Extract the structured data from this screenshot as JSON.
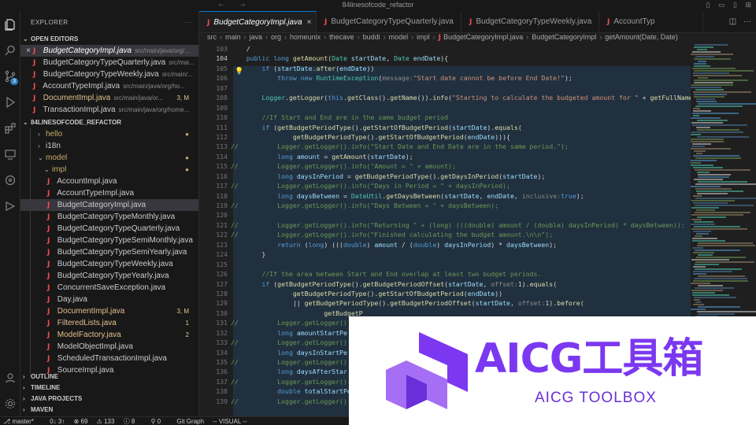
{
  "titlebar": {
    "title": "84linesofcode_refactor",
    "nav_back": "←",
    "nav_forward": "→"
  },
  "activity_bar": {
    "items": [
      "files-icon",
      "search-icon",
      "source-control-icon",
      "run-debug-icon",
      "extensions-icon",
      "remote-icon",
      "git-graph-icon",
      "testing-icon"
    ],
    "source_control_badge": "3"
  },
  "sidebar": {
    "header": "EXPLORER",
    "open_editors_title": "OPEN EDITORS",
    "open_editors": [
      {
        "name": "BudgetCategoryImpl.java",
        "path": "src/main/java/org/...",
        "selected": true,
        "status": ""
      },
      {
        "name": "BudgetCategoryTypeQuarterly.java",
        "path": "src/mai...",
        "status": ""
      },
      {
        "name": "BudgetCategoryTypeWeekly.java",
        "path": "src/main/...",
        "status": ""
      },
      {
        "name": "AccountTypeImpl.java",
        "path": "src/main/java/org/ho...",
        "status": ""
      },
      {
        "name": "DocumentImpl.java",
        "path": "src/main/java/or...",
        "status": "3, M",
        "modified": true
      },
      {
        "name": "TransactionImpl.java",
        "path": "src/main/java/org/home...",
        "status": ""
      }
    ],
    "project_title": "84LINESOFCODE_REFACTOR",
    "tree": [
      {
        "name": "hello",
        "type": "folder",
        "level": 1,
        "status": "",
        "dot": true
      },
      {
        "name": "i18n",
        "type": "folder",
        "level": 1,
        "status": ""
      },
      {
        "name": "model",
        "type": "folder-open",
        "level": 1,
        "status": "",
        "dot": true
      },
      {
        "name": "impl",
        "type": "folder-open",
        "level": 2,
        "status": "",
        "dot": true
      },
      {
        "name": "AccountImpl.java",
        "type": "file",
        "level": 3,
        "status": ""
      },
      {
        "name": "AccountTypeImpl.java",
        "type": "file",
        "level": 3,
        "status": ""
      },
      {
        "name": "BudgetCategoryImpl.java",
        "type": "file",
        "level": 3,
        "status": "",
        "selected": true
      },
      {
        "name": "BudgetCategoryTypeMonthly.java",
        "type": "file",
        "level": 3,
        "status": ""
      },
      {
        "name": "BudgetCategoryTypeQuarterly.java",
        "type": "file",
        "level": 3,
        "status": ""
      },
      {
        "name": "BudgetCategoryTypeSemiMonthly.java",
        "type": "file",
        "level": 3,
        "status": ""
      },
      {
        "name": "BudgetCategoryTypeSemiYearly.java",
        "type": "file",
        "level": 3,
        "status": ""
      },
      {
        "name": "BudgetCategoryTypeWeekly.java",
        "type": "file",
        "level": 3,
        "status": ""
      },
      {
        "name": "BudgetCategoryTypeYearly.java",
        "type": "file",
        "level": 3,
        "status": ""
      },
      {
        "name": "ConcurrentSaveException.java",
        "type": "file",
        "level": 3,
        "status": ""
      },
      {
        "name": "Day.java",
        "type": "file",
        "level": 3,
        "status": ""
      },
      {
        "name": "DocumentImpl.java",
        "type": "file",
        "level": 3,
        "status": "3, M",
        "modified": true
      },
      {
        "name": "FilteredLists.java",
        "type": "file",
        "level": 3,
        "status": "1",
        "modified": true
      },
      {
        "name": "ModelFactory.java",
        "type": "file",
        "level": 3,
        "status": "2",
        "modified": true
      },
      {
        "name": "ModelObjectImpl.java",
        "type": "file",
        "level": 3,
        "status": ""
      },
      {
        "name": "ScheduledTransactionImpl.java",
        "type": "file",
        "level": 3,
        "status": ""
      },
      {
        "name": "SourceImpl.java",
        "type": "file",
        "level": 3,
        "status": ""
      }
    ],
    "bottom_sections": [
      "OUTLINE",
      "TIMELINE",
      "JAVA PROJECTS",
      "MAVEN"
    ]
  },
  "tabs": [
    {
      "label": "BudgetCategoryImpl.java",
      "active": true
    },
    {
      "label": "BudgetCategoryTypeQuarterly.java"
    },
    {
      "label": "BudgetCategoryTypeWeekly.java"
    },
    {
      "label": "AccountTyp"
    }
  ],
  "breadcrumb": [
    "src",
    "main",
    "java",
    "org",
    "homeunix",
    "thecave",
    "buddi",
    "model",
    "impl",
    "BudgetCategoryImpl.java",
    "BudgetCategoryImpl",
    "getAmount(Date, Date)"
  ],
  "editor": {
    "line_numbers": [
      "103",
      "104",
      "105",
      "106",
      "107",
      "108",
      "109",
      "110",
      "111",
      "112",
      "113",
      "114",
      "115",
      "116",
      "117",
      "118",
      "119",
      "120",
      "121",
      "122",
      "123",
      "124",
      "125",
      "126",
      "127",
      "128",
      "129",
      "130",
      "131",
      "132",
      "133",
      "134",
      "135",
      "136",
      "137",
      "138",
      "139"
    ]
  },
  "statusbar": {
    "branch": "master*",
    "sync": "0↓ 3↑",
    "errors": "69",
    "warnings": "133",
    "info": "8",
    "ports": "0",
    "git_graph": "Git Graph",
    "mode": "-- VISUAL --"
  },
  "watermark": {
    "brand": "AICG工具箱",
    "sub": "AICG TOOLBOX"
  }
}
